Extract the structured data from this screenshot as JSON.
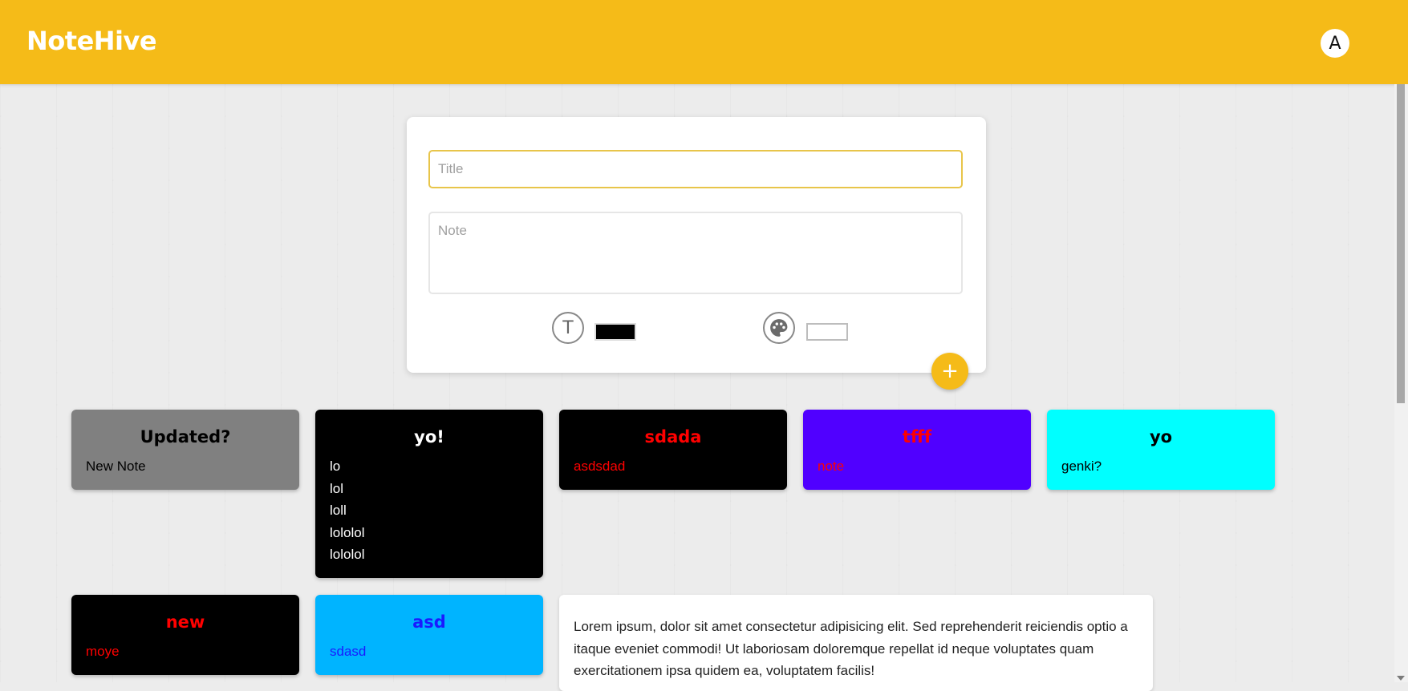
{
  "app": {
    "title": "NoteHive"
  },
  "user": {
    "avatar_letter": "A"
  },
  "composer": {
    "title_placeholder": "Title",
    "note_placeholder": "Note",
    "text_tool_glyph": "T",
    "text_color": "#000000",
    "bg_color": "#ffffff",
    "add_glyph": "+"
  },
  "icons": {
    "text_tool": "text-format-icon",
    "palette_tool": "palette-icon",
    "add": "plus-icon"
  },
  "notes": [
    {
      "title": "Updated?",
      "body": "New Note",
      "bg": "#808080",
      "color": "#000000"
    },
    {
      "title": "yo!",
      "body": "lo\nlol\nloll\nlololol\nlololol",
      "bg": "#000000",
      "color": "#ffffff"
    },
    {
      "title": "sdada",
      "body": "asdsdad",
      "bg": "#000000",
      "color": "#ff0000"
    },
    {
      "title": "tfff",
      "body": "note",
      "bg": "#5000ff",
      "color": "#ff0000"
    },
    {
      "title": "yo",
      "body": "genki?",
      "bg": "#00ffff",
      "color": "#000000"
    },
    {
      "title": "new",
      "body": "moye",
      "bg": "#000000",
      "color": "#ff0000"
    },
    {
      "title": "asd",
      "body": "sdasd",
      "bg": "#00b4ff",
      "color": "#1a1aff"
    }
  ],
  "lorem_note": {
    "title": "",
    "body": "Lorem ipsum, dolor sit amet consectetur adipisicing elit. Sed reprehenderit reiciendis optio a itaque eveniet commodi! Ut laboriosam doloremque repellat id neque voluptates quam exercitationem ipsa quidem ea, voluptatem facilis!",
    "bg": "#ffffff"
  }
}
